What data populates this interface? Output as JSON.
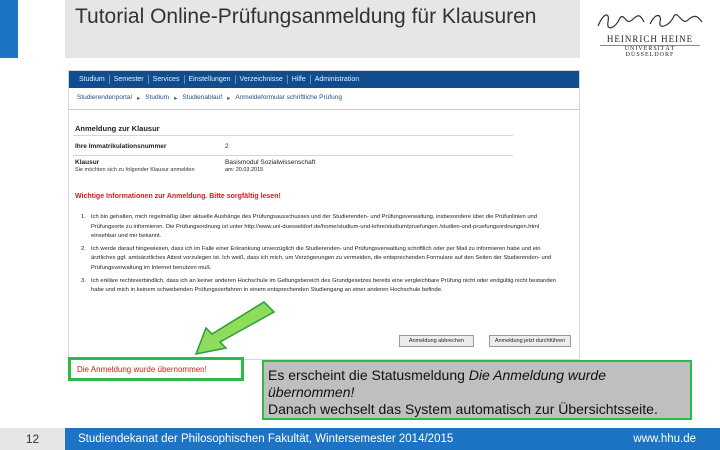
{
  "slide": {
    "title": "Tutorial Online-Prüfungsanmeldung für Klausuren",
    "page_number": "12",
    "footer_text": "Studiendekanat der Philosophischen Fakultät, Wintersemester 2014/2015",
    "footer_url": "www.hhu.de",
    "accent_color": "#1e74c4",
    "highlight_color": "#2cbb47"
  },
  "logo": {
    "line1": "HEINRICH HEINE",
    "line2": "UNIVERSITÄT DÜSSELDORF"
  },
  "screenshot": {
    "nav": [
      "Studium",
      "Semester",
      "Services",
      "Einstellungen",
      "Verzeichnisse",
      "Hilfe",
      "Administration"
    ],
    "breadcrumb": [
      "Studierendenportal",
      "Studium",
      "Studienablauf",
      "Anmeldeformular schriftliche Prüfung"
    ],
    "box_title": "Anmeldung zur Klausur",
    "matrikel_label": "Ihre Immatrikulationsnummer",
    "matrikel_value": "2",
    "klausur_label": "Klausur",
    "klausur_sub": "Sie möchten sich zu folgender Klausur anmelden",
    "klausur_value": "Basismodul Sozialwissenschaft",
    "klausur_date": "am: 20.03.2015",
    "warning": "Wichtige Informationen zur Anmeldung. Bitte sorgfältig lesen!",
    "items": [
      {
        "num": "1.",
        "text": "Ich bin gehalten, mich regelmäßig über aktuelle Aushänge des Prüfungsausschusses und der Studierenden- und Prüfungsverwaltung, insbesondere über die Prüfunlinien und Prüfungsorte zu informieren. Die Prüfungsordnung ist unter http://www.uni-duesseldorf.de/home/studium-und-lehre/studium/pruefungen /studien-und-pruefungsordnungen.html einsehbar und mir bekannt."
      },
      {
        "num": "2.",
        "text": "Ich werde darauf hingewiesen, dass ich im Falle einer Erkrankung unverzüglich die Studierenden- und Prüfungsverwaltung schriftlich oder per Mail zu informieren habe und ein ärztliches ggf. amtsärztliches Attest vorzulegen ist. Ich weiß, dass ich mich, um Verzögerungen zu vermeiden, die entsprechenden Formulare auf den Seiten der Studierenden- und Prüfungsverwaltung im Internet benutzen muß."
      },
      {
        "num": "3.",
        "text": "Ich erkläre rechtsverbindlich, dass ich an keiner anderen Hochschule im Geltungsbereich des Grundgesetzes bereits eine vergleichbare Prüfung nicht oder endgültig nicht bestanden habe und mich in keinem schwebenden Prüfungsverfahren in einem entsprechenden Studiengang an einer anderen Hochschule befinde."
      }
    ],
    "btn_cancel": "Anmeldung abbrechen",
    "btn_confirm": "Anmeldung jetzt durchführen"
  },
  "status_message": "Die Anmeldung wurde übernommen!",
  "callout": {
    "text1": "Es erscheint die Statusmeldung ",
    "text1_italic": "Die Anmeldung wurde übernommen!",
    "text2": "Danach wechselt das System automatisch zur Übersichtsseite."
  }
}
